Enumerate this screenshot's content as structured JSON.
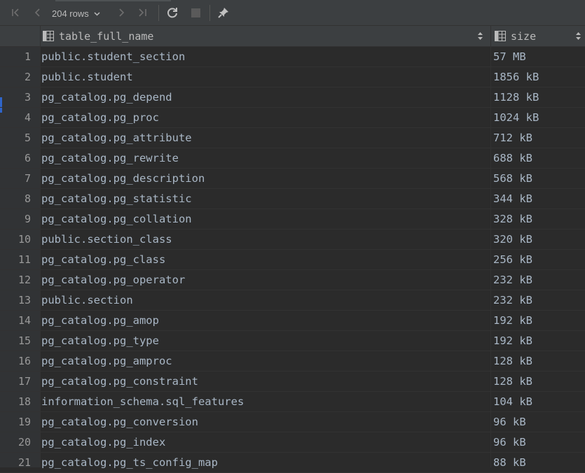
{
  "toolbar": {
    "rows_label": "204 rows",
    "icons": [
      "first-page-icon",
      "prev-page-icon",
      "chevron-down-icon",
      "next-page-icon",
      "last-page-icon",
      "reload-icon",
      "stop-icon",
      "pin-icon"
    ]
  },
  "columns": [
    {
      "label": "table_full_name"
    },
    {
      "label": "size"
    }
  ],
  "rows": [
    {
      "n": "1",
      "name": "public.student_section",
      "size": "57 MB"
    },
    {
      "n": "2",
      "name": "public.student",
      "size": "1856 kB"
    },
    {
      "n": "3",
      "name": "pg_catalog.pg_depend",
      "size": "1128 kB"
    },
    {
      "n": "4",
      "name": "pg_catalog.pg_proc",
      "size": "1024 kB"
    },
    {
      "n": "5",
      "name": "pg_catalog.pg_attribute",
      "size": "712 kB"
    },
    {
      "n": "6",
      "name": "pg_catalog.pg_rewrite",
      "size": "688 kB"
    },
    {
      "n": "7",
      "name": "pg_catalog.pg_description",
      "size": "568 kB"
    },
    {
      "n": "8",
      "name": "pg_catalog.pg_statistic",
      "size": "344 kB"
    },
    {
      "n": "9",
      "name": "pg_catalog.pg_collation",
      "size": "328 kB"
    },
    {
      "n": "10",
      "name": "public.section_class",
      "size": "320 kB"
    },
    {
      "n": "11",
      "name": "pg_catalog.pg_class",
      "size": "256 kB"
    },
    {
      "n": "12",
      "name": "pg_catalog.pg_operator",
      "size": "232 kB"
    },
    {
      "n": "13",
      "name": "public.section",
      "size": "232 kB"
    },
    {
      "n": "14",
      "name": "pg_catalog.pg_amop",
      "size": "192 kB"
    },
    {
      "n": "15",
      "name": "pg_catalog.pg_type",
      "size": "192 kB"
    },
    {
      "n": "16",
      "name": "pg_catalog.pg_amproc",
      "size": "128 kB"
    },
    {
      "n": "17",
      "name": "pg_catalog.pg_constraint",
      "size": "128 kB"
    },
    {
      "n": "18",
      "name": "information_schema.sql_features",
      "size": "104 kB"
    },
    {
      "n": "19",
      "name": "pg_catalog.pg_conversion",
      "size": "96 kB"
    },
    {
      "n": "20",
      "name": "pg_catalog.pg_index",
      "size": "96 kB"
    },
    {
      "n": "21",
      "name": "pg_catalog.pg_ts_config_map",
      "size": "88 kB"
    }
  ]
}
